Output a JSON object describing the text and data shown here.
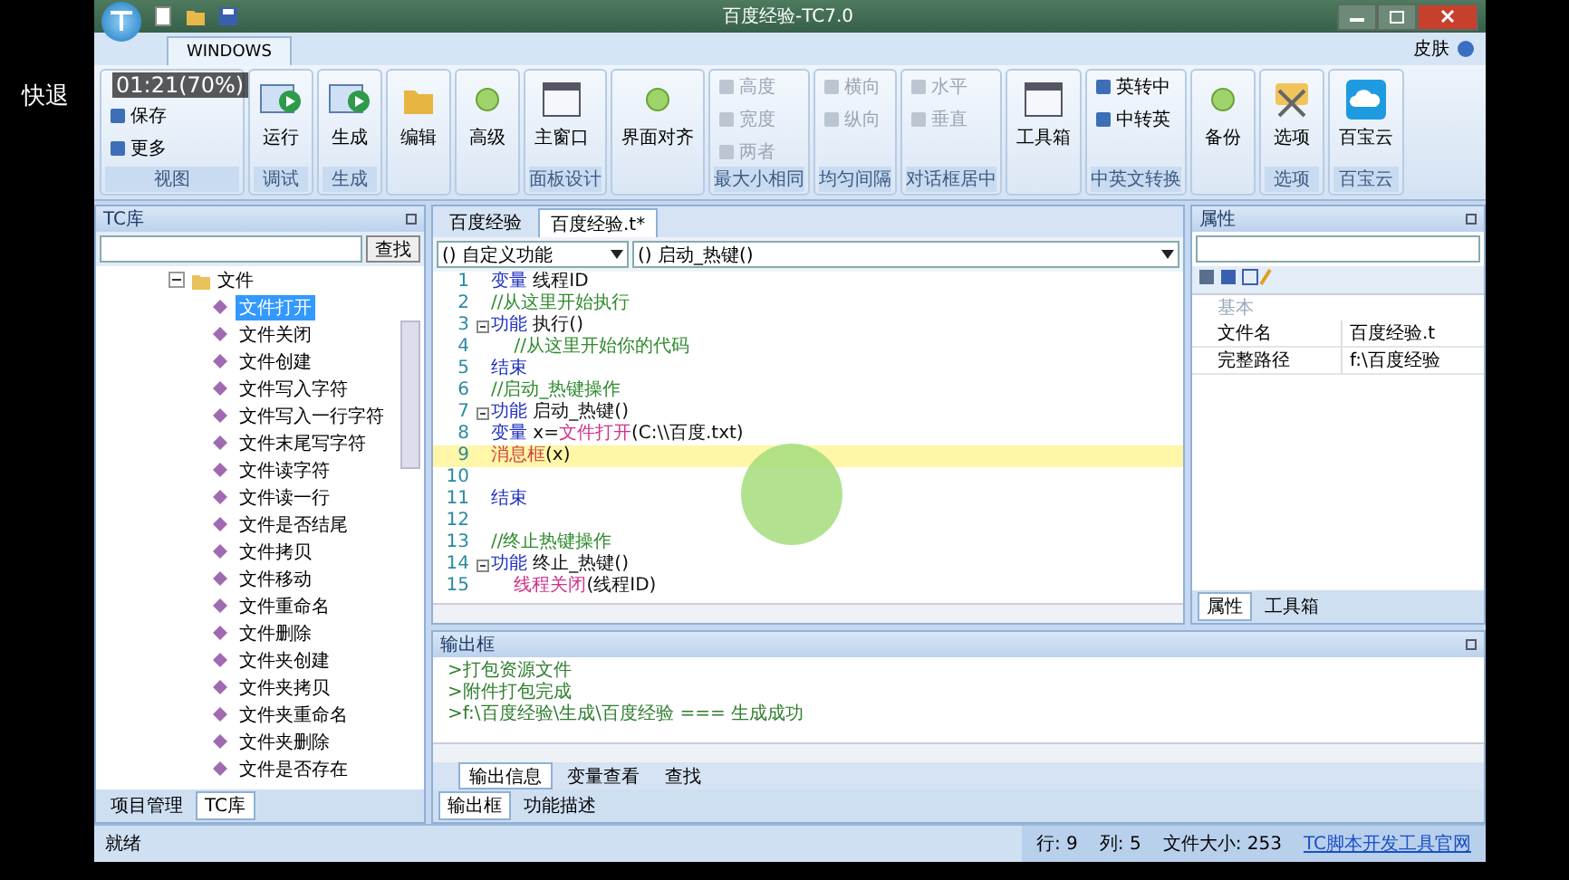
{
  "overlay": {
    "action": "快退",
    "time": "01:21(70%)"
  },
  "window": {
    "title": "百度经验-TC7.0"
  },
  "ribbon_tabs": [
    {
      "label": "WINDOWS",
      "selected": true
    }
  ],
  "skin_menu": "皮肤",
  "ribbon_groups": [
    {
      "label": "视图",
      "items": [
        {
          "kind": "small",
          "label": "保存",
          "disabled": false
        },
        {
          "kind": "small",
          "label": "更多",
          "disabled": false
        }
      ]
    },
    {
      "label": "调试",
      "items": [
        {
          "kind": "large",
          "label": "运行"
        }
      ]
    },
    {
      "label": "生成",
      "items": [
        {
          "kind": "large",
          "label": "生成"
        }
      ]
    },
    {
      "items": [
        {
          "kind": "large",
          "label": "编辑"
        }
      ]
    },
    {
      "items": [
        {
          "kind": "large",
          "label": "高级"
        }
      ]
    },
    {
      "label": "面板设计",
      "items": [
        {
          "kind": "large",
          "label": "主窗口"
        }
      ]
    },
    {
      "items": [
        {
          "kind": "large",
          "label": "界面对齐"
        }
      ]
    },
    {
      "label": "最大小相同",
      "items": [
        {
          "kind": "small",
          "label": "高度",
          "disabled": true
        },
        {
          "kind": "small",
          "label": "宽度",
          "disabled": true
        },
        {
          "kind": "small",
          "label": "两者",
          "disabled": true
        }
      ]
    },
    {
      "label": "均匀间隔",
      "items": [
        {
          "kind": "small",
          "label": "横向",
          "disabled": true
        },
        {
          "kind": "small",
          "label": "纵向",
          "disabled": true
        }
      ]
    },
    {
      "label": "对话框居中",
      "items": [
        {
          "kind": "small",
          "label": "水平",
          "disabled": true
        },
        {
          "kind": "small",
          "label": "垂直",
          "disabled": true
        }
      ]
    },
    {
      "items": [
        {
          "kind": "large",
          "label": "工具箱"
        }
      ]
    },
    {
      "label": "中英文转换",
      "items": [
        {
          "kind": "small",
          "label": "英转中",
          "disabled": false
        },
        {
          "kind": "small",
          "label": "中转英",
          "disabled": false
        }
      ]
    },
    {
      "items": [
        {
          "kind": "large",
          "label": "备份"
        }
      ]
    },
    {
      "label": "选项",
      "items": [
        {
          "kind": "large",
          "label": "选项"
        }
      ]
    },
    {
      "label": "百宝云",
      "items": [
        {
          "kind": "large",
          "label": "百宝云"
        }
      ]
    }
  ],
  "library_panel": {
    "title": "TC库",
    "search_button": "查找",
    "tree": [
      {
        "label": "文件",
        "expanded": true,
        "children": [
          {
            "label": "文件打开",
            "selected": true
          },
          {
            "label": "文件关闭",
            "selected": false
          },
          {
            "label": "文件创建",
            "selected": false
          },
          {
            "label": "文件写入字符",
            "selected": false
          },
          {
            "label": "文件写入一行字符",
            "selected": false
          },
          {
            "label": "文件末尾写字符",
            "selected": false
          },
          {
            "label": "文件读字符",
            "selected": false
          },
          {
            "label": "文件读一行",
            "selected": false
          },
          {
            "label": "文件是否结尾",
            "selected": false
          },
          {
            "label": "文件拷贝",
            "selected": false
          },
          {
            "label": "文件移动",
            "selected": false
          },
          {
            "label": "文件重命名",
            "selected": false
          },
          {
            "label": "文件删除",
            "selected": false
          },
          {
            "label": "文件夹创建",
            "selected": false
          },
          {
            "label": "文件夹拷贝",
            "selected": false
          },
          {
            "label": "文件夹重命名",
            "selected": false
          },
          {
            "label": "文件夹删除",
            "selected": false
          },
          {
            "label": "文件是否存在",
            "selected": false
          }
        ]
      }
    ],
    "tabs": [
      {
        "label": "项目管理",
        "selected": false
      },
      {
        "label": "TC库",
        "selected": true
      }
    ]
  },
  "editor": {
    "tabs": [
      {
        "label": "百度经验",
        "selected": false
      },
      {
        "label": "百度经验.t*",
        "selected": true
      }
    ],
    "scope_dropdown": "() 自定义功能",
    "function_dropdown": "() 启动_热键()",
    "lines": [
      {
        "number": "1",
        "fold": false,
        "highlighted": false,
        "tokens": [
          {
            "kind": "keyword",
            "text": "变量"
          },
          {
            "kind": "plain",
            "text": " 线程ID"
          }
        ]
      },
      {
        "number": "2",
        "fold": false,
        "highlighted": false,
        "tokens": [
          {
            "kind": "comment",
            "text": "//从这里开始执行"
          }
        ]
      },
      {
        "number": "3",
        "fold": true,
        "highlighted": false,
        "tokens": [
          {
            "kind": "keyword",
            "text": "功能"
          },
          {
            "kind": "plain",
            "text": " 执行()"
          }
        ]
      },
      {
        "number": "4",
        "fold": false,
        "highlighted": false,
        "tokens": [
          {
            "kind": "comment",
            "text": "    //从这里开始你的代码"
          }
        ]
      },
      {
        "number": "5",
        "fold": false,
        "highlighted": false,
        "tokens": [
          {
            "kind": "keyword",
            "text": "结束"
          }
        ]
      },
      {
        "number": "6",
        "fold": false,
        "highlighted": false,
        "tokens": [
          {
            "kind": "comment",
            "text": "//启动_热键操作"
          }
        ]
      },
      {
        "number": "7",
        "fold": true,
        "highlighted": false,
        "tokens": [
          {
            "kind": "keyword",
            "text": "功能"
          },
          {
            "kind": "plain",
            "text": " 启动_热键()"
          }
        ]
      },
      {
        "number": "8",
        "fold": false,
        "highlighted": false,
        "tokens": [
          {
            "kind": "keyword",
            "text": "变量"
          },
          {
            "kind": "plain",
            "text": " x="
          },
          {
            "kind": "function",
            "text": "文件打开"
          },
          {
            "kind": "plain",
            "text": "(C:\\\\百度.txt)"
          }
        ]
      },
      {
        "number": "9",
        "fold": false,
        "highlighted": true,
        "tokens": [
          {
            "kind": "builtin",
            "text": "消息框"
          },
          {
            "kind": "plain",
            "text": "(x)"
          }
        ]
      },
      {
        "number": "10",
        "fold": false,
        "highlighted": false
      },
      {
        "number": "11",
        "fold": false,
        "highlighted": false,
        "tokens": [
          {
            "kind": "keyword",
            "text": "结束"
          }
        ]
      },
      {
        "number": "12",
        "fold": false,
        "highlighted": false
      },
      {
        "number": "13",
        "fold": false,
        "highlighted": false,
        "tokens": [
          {
            "kind": "comment",
            "text": "//终止热键操作"
          }
        ]
      },
      {
        "number": "14",
        "fold": true,
        "highlighted": false,
        "tokens": [
          {
            "kind": "keyword",
            "text": "功能"
          },
          {
            "kind": "plain",
            "text": " 终止_热键()"
          }
        ]
      },
      {
        "number": "15",
        "fold": false,
        "highlighted": false,
        "tokens": [
          {
            "kind": "function",
            "text": "    线程关闭"
          },
          {
            "kind": "plain",
            "text": "(线程ID)"
          }
        ]
      }
    ]
  },
  "properties_panel": {
    "title": "属性",
    "category": "基本",
    "rows": [
      {
        "name": "文件名",
        "value": "百度经验.t"
      },
      {
        "name": "完整路径",
        "value": "f:\\百度经验"
      }
    ],
    "tabs": [
      {
        "label": "属性",
        "selected": true
      },
      {
        "label": "工具箱",
        "selected": false
      }
    ]
  },
  "output_panel": {
    "title": "输出框",
    "lines": [
      ">打包资源文件",
      ">附件打包完成",
      ">f:\\百度经验\\生成\\百度经验 === 生成成功"
    ],
    "tabs": [
      {
        "label": "输出信息",
        "selected": true
      },
      {
        "label": "变量查看",
        "selected": false
      },
      {
        "label": "查找",
        "selected": false
      }
    ],
    "bottom_tabs": [
      {
        "label": "输出框",
        "selected": true
      },
      {
        "label": "功能描述",
        "selected": false
      }
    ]
  },
  "status_bar": {
    "message": "就绪",
    "row": "行: 9",
    "column": "列: 5",
    "file_size": "文件大小: 253",
    "link": "TC脚本开发工具官网"
  }
}
